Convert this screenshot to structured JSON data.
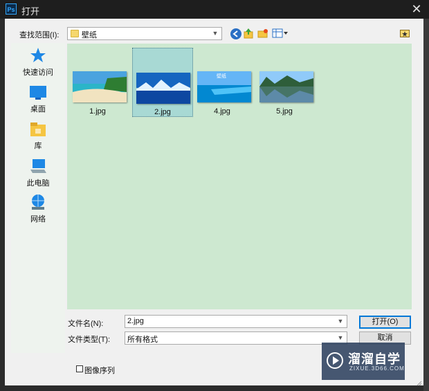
{
  "window": {
    "title": "打开",
    "app_icon_text": "Ps"
  },
  "lookin": {
    "label": "查找范围(I):",
    "value": "壁纸"
  },
  "places": [
    {
      "label": "快速访问",
      "icon": "star-icon"
    },
    {
      "label": "桌面",
      "icon": "desktop-icon"
    },
    {
      "label": "库",
      "icon": "library-icon"
    },
    {
      "label": "此电脑",
      "icon": "computer-icon"
    },
    {
      "label": "网络",
      "icon": "network-icon"
    }
  ],
  "files": [
    {
      "name": "1.jpg",
      "selected": false,
      "image_overlay_text": ""
    },
    {
      "name": "2.jpg",
      "selected": true,
      "image_overlay_text": ""
    },
    {
      "name": "4.jpg",
      "selected": false,
      "image_overlay_text": "壁纸"
    },
    {
      "name": "5.jpg",
      "selected": false,
      "image_overlay_text": ""
    }
  ],
  "filename": {
    "label": "文件名(N):",
    "value": "2.jpg"
  },
  "filetype": {
    "label": "文件类型(T):",
    "value": "所有格式"
  },
  "buttons": {
    "open": "打开(O)",
    "cancel": "取消"
  },
  "image_sequence": {
    "label": "图像序列",
    "checked": false
  },
  "watermark": {
    "title": "溜溜自学",
    "subtitle": "ZIXUE.3D66.COM"
  }
}
